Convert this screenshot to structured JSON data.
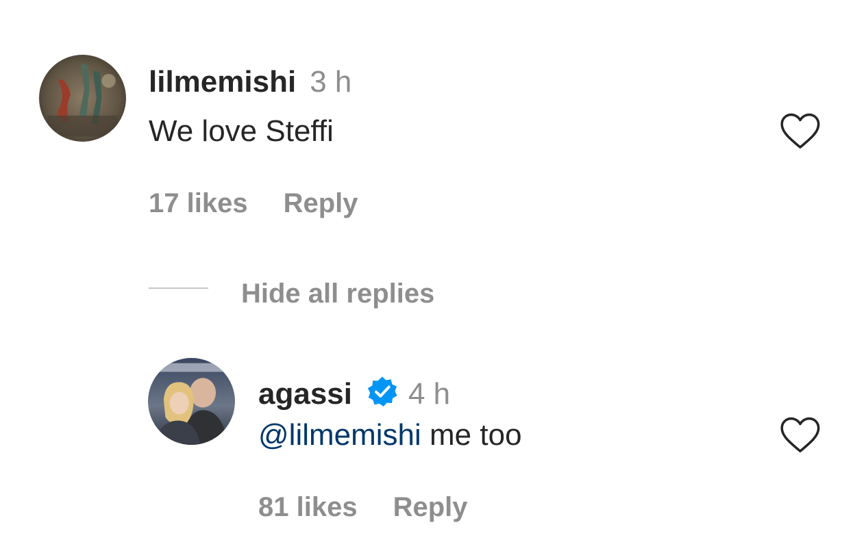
{
  "comment": {
    "username": "lilmemishi",
    "time": "3 h",
    "text": "We love Steffi",
    "likes": "17 likes",
    "reply_label": "Reply"
  },
  "replies_toggle": {
    "label": "Hide all replies"
  },
  "reply": {
    "username": "agassi",
    "time": "4 h",
    "mention": "@lilmemishi",
    "text": " me too",
    "likes": "81 likes",
    "reply_label": "Reply"
  },
  "colors": {
    "text": "#262626",
    "secondary": "#8e8e8e",
    "mention": "#00376b",
    "verified": "#0095f6"
  },
  "icons": {
    "like": "heart-outline-icon",
    "verified": "verified-badge-icon"
  }
}
